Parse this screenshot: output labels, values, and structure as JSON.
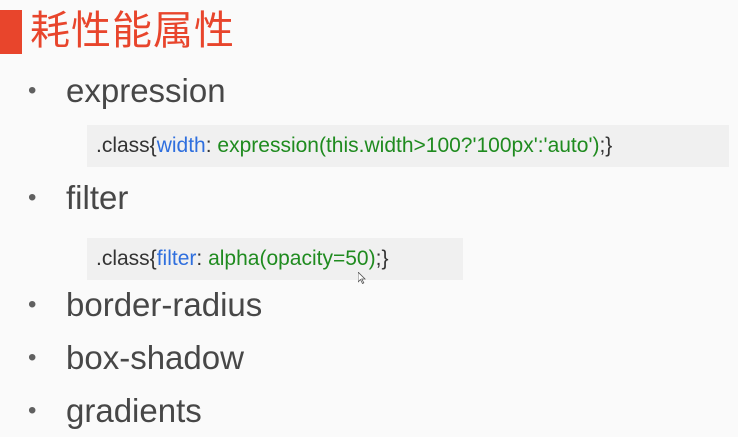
{
  "header": {
    "title": "耗性能属性",
    "accent_color": "#e8452c"
  },
  "items": [
    {
      "bullet": "•",
      "label": "expression",
      "code": {
        "selector": ".class{",
        "property": "width",
        "colon": ":",
        "value": "expression(this.width>100?'100px':'auto')",
        "end": ";}"
      }
    },
    {
      "bullet": "•",
      "label": "filter",
      "code": {
        "selector": ".class{",
        "property": "filter",
        "colon": ":",
        "value": "alpha(opacity=50)",
        "end": ";}"
      }
    },
    {
      "bullet": "•",
      "label": "border-radius"
    },
    {
      "bullet": "•",
      "label": "box-shadow"
    },
    {
      "bullet": "•",
      "label": "gradients"
    }
  ],
  "colors": {
    "property": "#2f6fde",
    "value": "#1f8b1f",
    "text": "#474747",
    "code_bg": "#f0f0f0"
  },
  "icons": {
    "cursor": "mouse-cursor-icon"
  }
}
